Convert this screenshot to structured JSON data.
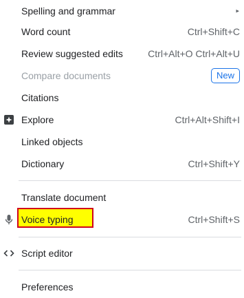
{
  "menu": {
    "items": [
      {
        "label": "Spelling and grammar",
        "submenu": "▸"
      },
      {
        "label": "Word count",
        "shortcut": "Ctrl+Shift+C"
      },
      {
        "label": "Review suggested edits",
        "shortcut": "Ctrl+Alt+O Ctrl+Alt+U"
      },
      {
        "label": "Compare documents",
        "badge": "New",
        "disabled": true
      },
      {
        "label": "Citations"
      },
      {
        "label": "Explore",
        "shortcut": "Ctrl+Alt+Shift+I",
        "icon": "explore-icon"
      },
      {
        "label": "Linked objects"
      },
      {
        "label": "Dictionary",
        "shortcut": "Ctrl+Shift+Y"
      },
      {
        "label": "Translate document"
      },
      {
        "label": "Voice typing",
        "shortcut": "Ctrl+Shift+S",
        "icon": "microphone-icon",
        "highlighted": true
      },
      {
        "label": "Script editor",
        "icon": "code-icon"
      },
      {
        "label": "Preferences"
      }
    ]
  },
  "colors": {
    "highlight_fill": "#ffff00",
    "highlight_border": "#d0021b",
    "badge": "#1a73e8",
    "divider": "#dadce0"
  }
}
